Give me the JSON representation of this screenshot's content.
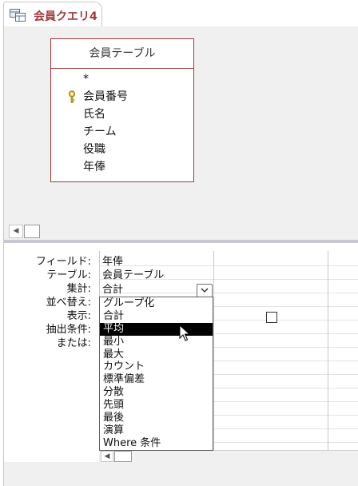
{
  "tab": {
    "title": "会員クエリ4",
    "icon": "query-icon",
    "accent": "#a4373a"
  },
  "table": {
    "title": "会員テーブル",
    "fields": [
      "*",
      "会員番号",
      "氏名",
      "チーム",
      "役職",
      "年俸"
    ],
    "key_field_index": 1
  },
  "grid": {
    "row_labels": {
      "field": "フィールド:",
      "table": "テーブル:",
      "total": "集計:",
      "sort": "並べ替え:",
      "show": "表示:",
      "criteria": "抽出条件:",
      "or": "または:"
    },
    "column1": {
      "field": "年俸",
      "table": "会員テーブル",
      "total": "合計"
    },
    "total_options": [
      "グループ化",
      "合計",
      "平均",
      "最小",
      "最大",
      "カウント",
      "標準偏差",
      "分散",
      "先頭",
      "最後",
      "演算",
      "Where 条件"
    ],
    "highlighted_option": "平均"
  },
  "colors": {
    "design_bg": "#f0f0f0",
    "selection": "#000000",
    "table_border": "#a4373a"
  }
}
